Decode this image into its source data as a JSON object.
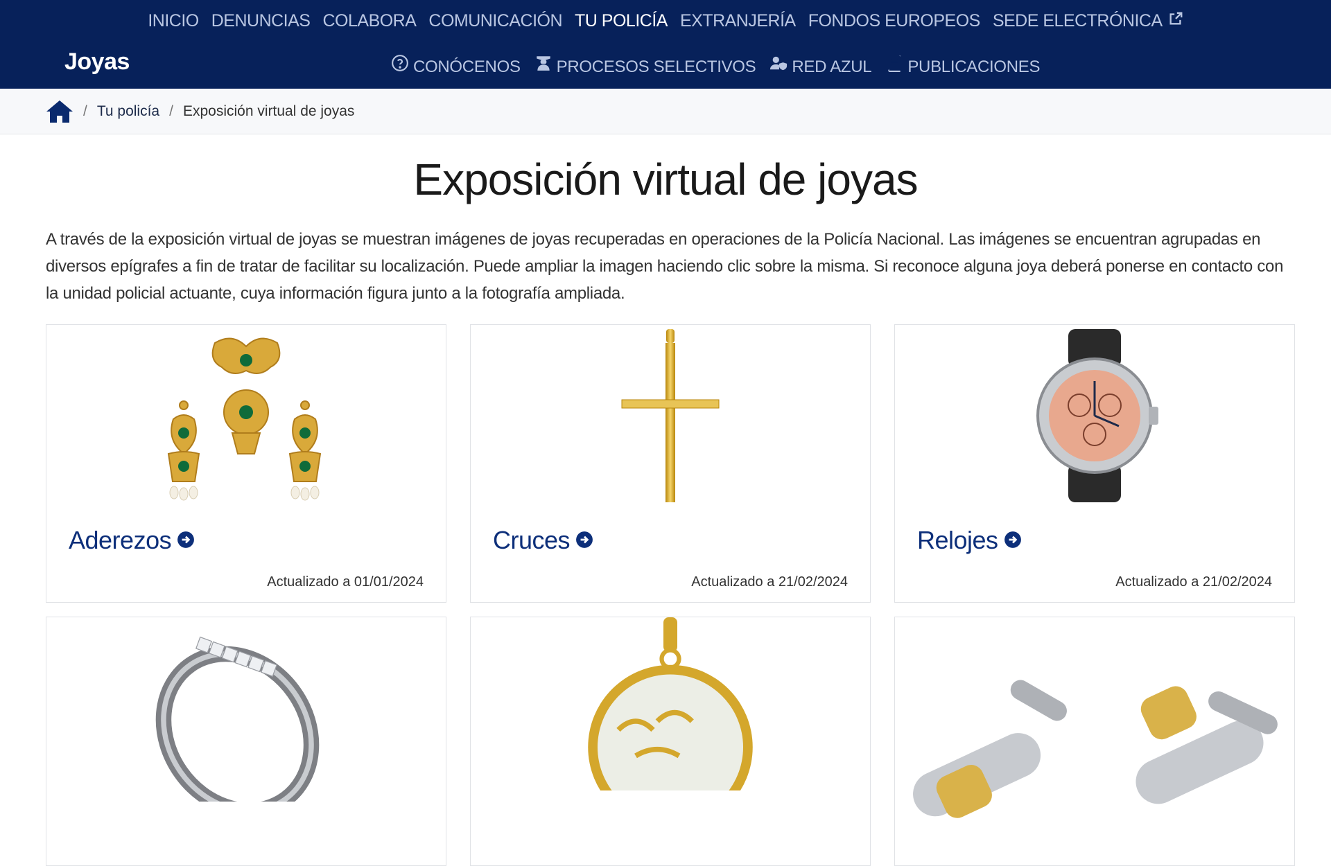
{
  "header": {
    "main_nav": [
      {
        "label": "INICIO",
        "active": false
      },
      {
        "label": "DENUNCIAS",
        "active": false
      },
      {
        "label": "COLABORA",
        "active": false
      },
      {
        "label": "COMUNICACIÓN",
        "active": false
      },
      {
        "label": "TU POLICÍA",
        "active": true
      },
      {
        "label": "EXTRANJERÍA",
        "active": false
      },
      {
        "label": "FONDOS EUROPEOS",
        "active": false
      },
      {
        "label": "SEDE ELECTRÓNICA",
        "active": false,
        "icon": "external-link-icon"
      }
    ],
    "site_title": "Joyas",
    "sub_nav": [
      {
        "label": "CONÓCENOS",
        "icon": "question-circle-icon"
      },
      {
        "label": "PROCESOS SELECTIVOS",
        "icon": "graduate-icon"
      },
      {
        "label": "RED AZUL",
        "icon": "user-shield-icon"
      },
      {
        "label": "PUBLICACIONES",
        "icon": "book-icon"
      }
    ]
  },
  "breadcrumb": {
    "home_icon": "home-icon",
    "items": [
      "Tu policía",
      "Exposición virtual de joyas"
    ]
  },
  "main": {
    "title": "Exposición virtual de joyas",
    "intro": "A través de la exposición virtual de joyas se muestran imágenes de joyas recuperadas en operaciones de la Policía Nacional. Las imágenes se encuentran agrupadas en diversos epígrafes a fin de tratar de facilitar su localización. Puede ampliar la imagen haciendo clic sobre la misma. Si reconoce alguna joya deberá ponerse en contacto con la unidad policial actuante, cuya información figura junto a la fotografía ampliada.",
    "cards": [
      {
        "label": "Aderezos",
        "updated": "Actualizado a 01/01/2024",
        "image": "earrings-set"
      },
      {
        "label": "Cruces",
        "updated": "Actualizado a 21/02/2024",
        "image": "gold-cross"
      },
      {
        "label": "Relojes",
        "updated": "Actualizado a 21/02/2024",
        "image": "watch"
      }
    ],
    "cards_row2_images": [
      "ring",
      "medal-pendant",
      "cufflinks"
    ]
  },
  "colors": {
    "header_bg": "#07215a",
    "link": "#0d2f7a",
    "nav_text": "#b9c6e2"
  }
}
